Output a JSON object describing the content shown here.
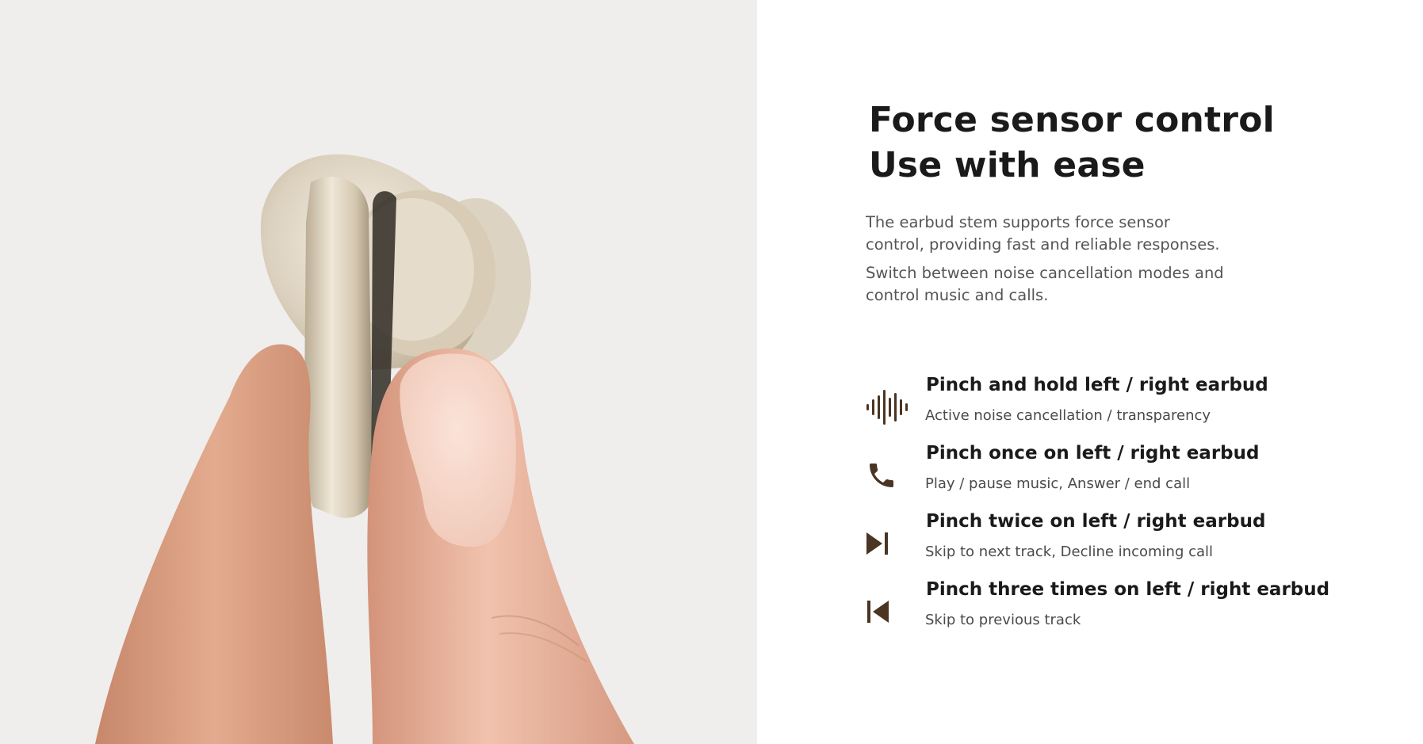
{
  "hero": {
    "title_line1": "Force sensor control",
    "title_line2": "Use with ease",
    "description_p1": "The earbud stem supports force sensor control, providing fast and reliable responses.",
    "description_p2": "Switch between noise cancellation modes and control music and calls."
  },
  "features": [
    {
      "icon": "soundwave-icon",
      "title": "Pinch and hold left / right earbud",
      "description": "Active noise cancellation / transparency"
    },
    {
      "icon": "phone-icon",
      "title": "Pinch once on left / right earbud",
      "description": "Play / pause music, Answer / end call"
    },
    {
      "icon": "skip-next-icon",
      "title": "Pinch twice on left / right earbud",
      "description": "Skip to next track, Decline incoming call"
    },
    {
      "icon": "skip-previous-icon",
      "title": "Pinch three times on left / right earbud",
      "description": "Skip to previous track"
    }
  ],
  "colors": {
    "icon_brown": "#4a3422",
    "photo_background": "#efeeec",
    "title_text": "#1a1a1a",
    "body_text": "#555555"
  }
}
